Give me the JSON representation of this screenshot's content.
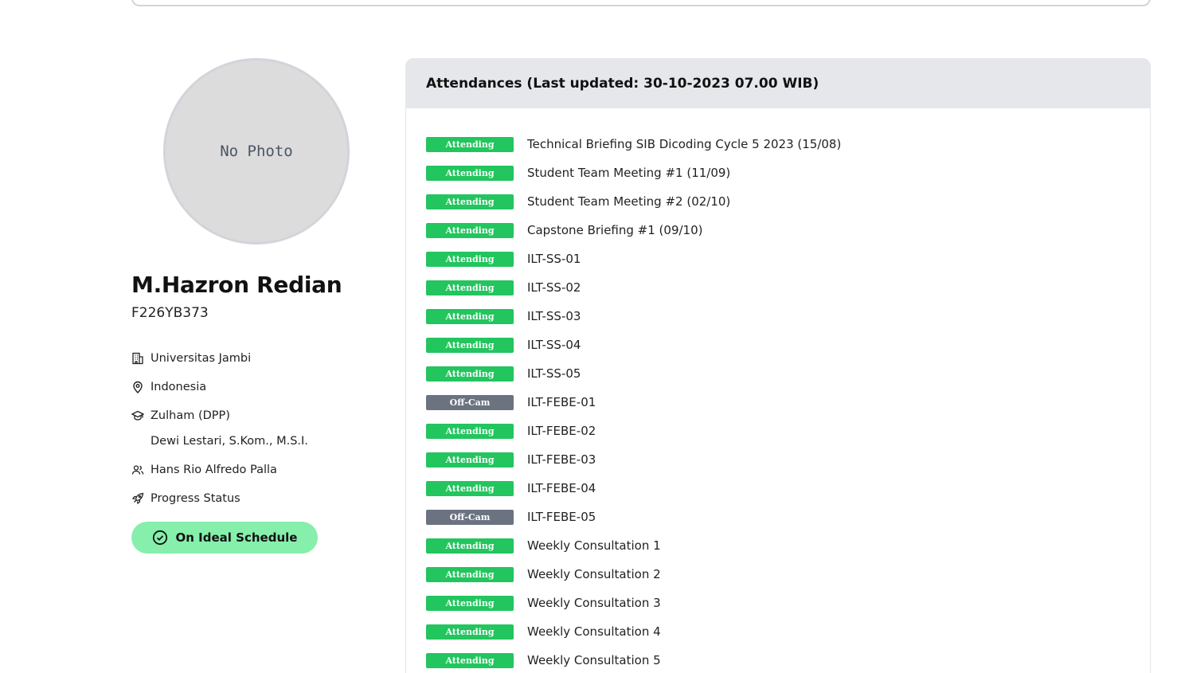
{
  "profile": {
    "photo_placeholder": "No Photo",
    "name": "M.Hazron Redian",
    "student_id": "F226YB373",
    "university": "Universitas Jambi",
    "country": "Indonesia",
    "mentor": "Zulham (DPP)",
    "advisor": "Dewi Lestari, S.Kom., M.S.I.",
    "team_member": "Hans Rio Alfredo Palla",
    "progress_label": "Progress Status",
    "status": "On Ideal Schedule",
    "status_color": "#86efac"
  },
  "attendance": {
    "header": "Attendances (Last updated: 30-10-2023 07.00 WIB)",
    "colors": {
      "attending": "#22c55e",
      "offcam": "#6b7280"
    },
    "items": [
      {
        "status": "Attending",
        "type": "attending",
        "title": "Technical Briefing SIB Dicoding Cycle 5 2023 (15/08)"
      },
      {
        "status": "Attending",
        "type": "attending",
        "title": "Student Team Meeting #1 (11/09)"
      },
      {
        "status": "Attending",
        "type": "attending",
        "title": "Student Team Meeting #2 (02/10)"
      },
      {
        "status": "Attending",
        "type": "attending",
        "title": "Capstone Briefing #1 (09/10)"
      },
      {
        "status": "Attending",
        "type": "attending",
        "title": "ILT-SS-01"
      },
      {
        "status": "Attending",
        "type": "attending",
        "title": "ILT-SS-02"
      },
      {
        "status": "Attending",
        "type": "attending",
        "title": "ILT-SS-03"
      },
      {
        "status": "Attending",
        "type": "attending",
        "title": "ILT-SS-04"
      },
      {
        "status": "Attending",
        "type": "attending",
        "title": "ILT-SS-05"
      },
      {
        "status": "Off-Cam",
        "type": "offcam",
        "title": "ILT-FEBE-01"
      },
      {
        "status": "Attending",
        "type": "attending",
        "title": "ILT-FEBE-02"
      },
      {
        "status": "Attending",
        "type": "attending",
        "title": "ILT-FEBE-03"
      },
      {
        "status": "Attending",
        "type": "attending",
        "title": "ILT-FEBE-04"
      },
      {
        "status": "Off-Cam",
        "type": "offcam",
        "title": "ILT-FEBE-05"
      },
      {
        "status": "Attending",
        "type": "attending",
        "title": "Weekly Consultation 1"
      },
      {
        "status": "Attending",
        "type": "attending",
        "title": "Weekly Consultation 2"
      },
      {
        "status": "Attending",
        "type": "attending",
        "title": "Weekly Consultation 3"
      },
      {
        "status": "Attending",
        "type": "attending",
        "title": "Weekly Consultation 4"
      },
      {
        "status": "Attending",
        "type": "attending",
        "title": "Weekly Consultation 5"
      }
    ]
  }
}
